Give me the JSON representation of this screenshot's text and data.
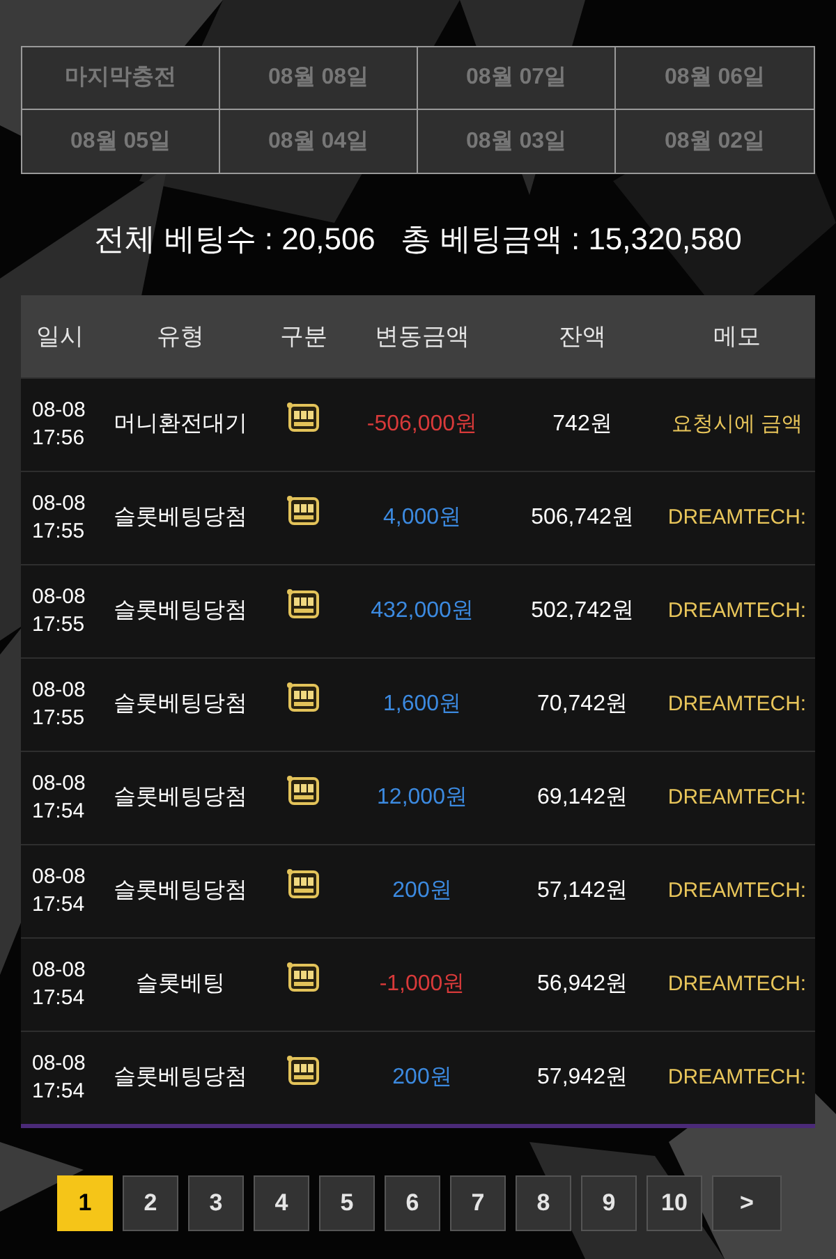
{
  "date_tabs": [
    {
      "label": "마지막충전",
      "selected": false
    },
    {
      "label": "08월 08일",
      "selected": false
    },
    {
      "label": "08월 07일",
      "selected": false
    },
    {
      "label": "08월 06일",
      "selected": false
    },
    {
      "label": "08월 05일",
      "selected": false
    },
    {
      "label": "08월 04일",
      "selected": false
    },
    {
      "label": "08월 03일",
      "selected": false
    },
    {
      "label": "08월 02일",
      "selected": false
    }
  ],
  "summary": "전체 베팅수 : 20,506   총 베팅금액 : 15,320,580",
  "table": {
    "columns": [
      "일시",
      "유형",
      "구분",
      "변동금액",
      "잔액",
      "메모"
    ],
    "rows": [
      {
        "date": "08-08",
        "time": "17:56",
        "type": "머니환전대기",
        "amount": "-506,000원",
        "color": "#d83a3a",
        "balance": "742원",
        "memo": "요청시에 금액"
      },
      {
        "date": "08-08",
        "time": "17:55",
        "type": "슬롯베팅당첨",
        "amount": "4,000원",
        "color": "#3c8ae0",
        "balance": "506,742원",
        "memo": "DREAMTECH:"
      },
      {
        "date": "08-08",
        "time": "17:55",
        "type": "슬롯베팅당첨",
        "amount": "432,000원",
        "color": "#3c8ae0",
        "balance": "502,742원",
        "memo": "DREAMTECH:"
      },
      {
        "date": "08-08",
        "time": "17:55",
        "type": "슬롯베팅당첨",
        "amount": "1,600원",
        "color": "#3c8ae0",
        "balance": "70,742원",
        "memo": "DREAMTECH:"
      },
      {
        "date": "08-08",
        "time": "17:54",
        "type": "슬롯베팅당첨",
        "amount": "12,000원",
        "color": "#3c8ae0",
        "balance": "69,142원",
        "memo": "DREAMTECH:"
      },
      {
        "date": "08-08",
        "time": "17:54",
        "type": "슬롯베팅당첨",
        "amount": "200원",
        "color": "#3c8ae0",
        "balance": "57,142원",
        "memo": "DREAMTECH:"
      },
      {
        "date": "08-08",
        "time": "17:54",
        "type": "슬롯베팅",
        "amount": "-1,000원",
        "color": "#d83a3a",
        "balance": "56,942원",
        "memo": "DREAMTECH:"
      },
      {
        "date": "08-08",
        "time": "17:54",
        "type": "슬롯베팅당첨",
        "amount": "200원",
        "color": "#3c8ae0",
        "balance": "57,942원",
        "memo": "DREAMTECH:"
      }
    ]
  },
  "pagination": [
    {
      "label": "1",
      "selected": true
    },
    {
      "label": "2",
      "selected": false
    },
    {
      "label": "3",
      "selected": false
    },
    {
      "label": "4",
      "selected": false
    },
    {
      "label": "5",
      "selected": false
    },
    {
      "label": "6",
      "selected": false
    },
    {
      "label": "7",
      "selected": false
    },
    {
      "label": "8",
      "selected": false
    },
    {
      "label": "9",
      "selected": false
    },
    {
      "label": "10",
      "selected": false
    },
    {
      "label": ">",
      "selected": false
    }
  ]
}
